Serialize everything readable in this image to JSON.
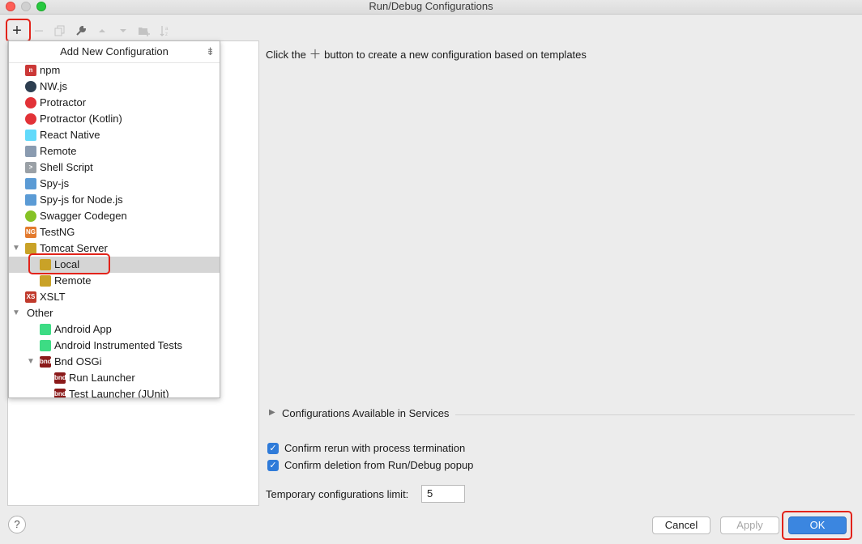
{
  "window": {
    "title": "Run/Debug Configurations"
  },
  "toolbar": {
    "icons": [
      "plus-icon",
      "minus-icon",
      "copy-icon",
      "wrench-icon",
      "arrow-up-icon",
      "arrow-down-icon",
      "folder-add-icon",
      "sort-icon"
    ],
    "plus_label": "+"
  },
  "popup": {
    "title": "Add New Configuration",
    "items": [
      {
        "label": "npm",
        "icon": "npm-icon",
        "indent": 1,
        "color": "#cb3837",
        "glyph": "n"
      },
      {
        "label": "NW.js",
        "icon": "nwjs-icon",
        "indent": 1,
        "color": "#2d3e50",
        "glyph": ""
      },
      {
        "label": "Protractor",
        "icon": "protractor-icon",
        "indent": 1,
        "color": "#e23237",
        "glyph": ""
      },
      {
        "label": "Protractor (Kotlin)",
        "icon": "protractor-icon",
        "indent": 1,
        "color": "#e23237",
        "glyph": ""
      },
      {
        "label": "React Native",
        "icon": "react-icon",
        "indent": 1,
        "color": "#61dafb",
        "glyph": ""
      },
      {
        "label": "Remote",
        "icon": "remote-icon",
        "indent": 1,
        "color": "#8a9bb0",
        "glyph": ""
      },
      {
        "label": "Shell Script",
        "icon": "shell-icon",
        "indent": 1,
        "color": "#9aa0a6",
        "glyph": ">"
      },
      {
        "label": "Spy-js",
        "icon": "spyjs-icon",
        "indent": 1,
        "color": "#5b9bd5",
        "glyph": ""
      },
      {
        "label": "Spy-js for Node.js",
        "icon": "spyjs-node-icon",
        "indent": 1,
        "color": "#5b9bd5",
        "glyph": ""
      },
      {
        "label": "Swagger Codegen",
        "icon": "swagger-icon",
        "indent": 1,
        "color": "#85c225",
        "glyph": ""
      },
      {
        "label": "TestNG",
        "icon": "testng-icon",
        "indent": 1,
        "color": "#e37a2d",
        "glyph": "NG"
      },
      {
        "label": "Tomcat Server",
        "icon": "tomcat-icon",
        "indent": 1,
        "color": "#c9a227",
        "glyph": "",
        "expanded": true
      },
      {
        "label": "Local",
        "icon": "tomcat-icon",
        "indent": 2,
        "color": "#c9a227",
        "glyph": "",
        "selected": true
      },
      {
        "label": "Remote",
        "icon": "tomcat-icon",
        "indent": 2,
        "color": "#c9a227",
        "glyph": ""
      },
      {
        "label": "XSLT",
        "icon": "xslt-icon",
        "indent": 1,
        "color": "#c0392b",
        "glyph": "XS"
      },
      {
        "label": "Other",
        "icon": "",
        "indent": 0,
        "color": "",
        "glyph": "",
        "expanded": true
      },
      {
        "label": "Android App",
        "icon": "android-icon",
        "indent": 2,
        "color": "#3ddc84",
        "glyph": ""
      },
      {
        "label": "Android Instrumented Tests",
        "icon": "android-icon",
        "indent": 2,
        "color": "#3ddc84",
        "glyph": ""
      },
      {
        "label": "Bnd OSGi",
        "icon": "bnd-icon",
        "indent": 2,
        "color": "#8b1a1a",
        "glyph": "bnd",
        "expanded": true,
        "hasArrow": true
      },
      {
        "label": "Run Launcher",
        "icon": "bnd-run-icon",
        "indent": 3,
        "color": "#8b1a1a",
        "glyph": "bnd"
      },
      {
        "label": "Test Launcher (JUnit)",
        "icon": "bnd-test-icon",
        "indent": 3,
        "color": "#8b1a1a",
        "glyph": "bnd"
      }
    ]
  },
  "main": {
    "hint_before": "Click the",
    "hint_after": "button to create a new configuration based on templates",
    "services_label": "Configurations Available in Services",
    "checkbox1": "Confirm rerun with process termination",
    "checkbox2": "Confirm deletion from Run/Debug popup",
    "limit_label": "Temporary configurations limit:",
    "limit_value": "5"
  },
  "buttons": {
    "help": "?",
    "cancel": "Cancel",
    "apply": "Apply",
    "ok": "OK"
  },
  "colors": {
    "accent": "#3b86e0",
    "highlight": "#e2231a"
  }
}
